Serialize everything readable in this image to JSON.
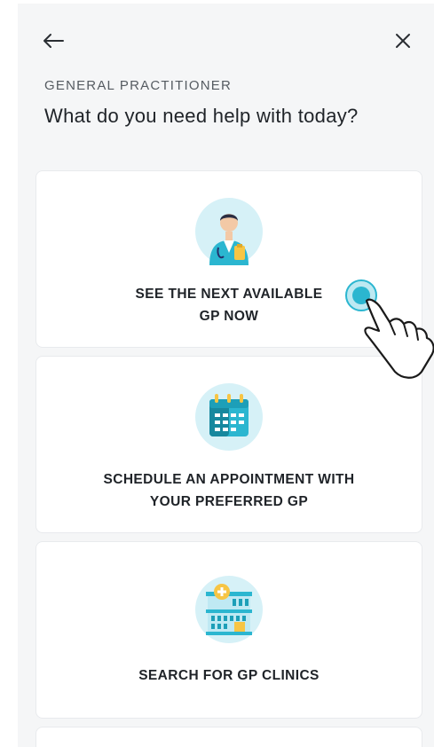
{
  "header": {
    "back_icon": "arrow-left-icon",
    "close_icon": "close-icon",
    "subtitle": "GENERAL PRACTITIONER",
    "title": "What do you need help with today?"
  },
  "options": [
    {
      "icon": "doctor-icon",
      "label": "SEE THE NEXT AVAILABLE\nGP NOW"
    },
    {
      "icon": "calendar-icon",
      "label": "SCHEDULE AN APPOINTMENT WITH\nYOUR PREFERRED GP"
    },
    {
      "icon": "hospital-building-icon",
      "label": "SEARCH FOR GP CLINICS"
    }
  ],
  "colors": {
    "accent": "#2bb6d0",
    "icon_bg": "#d6f1f7",
    "background": "#f5f6f7"
  }
}
